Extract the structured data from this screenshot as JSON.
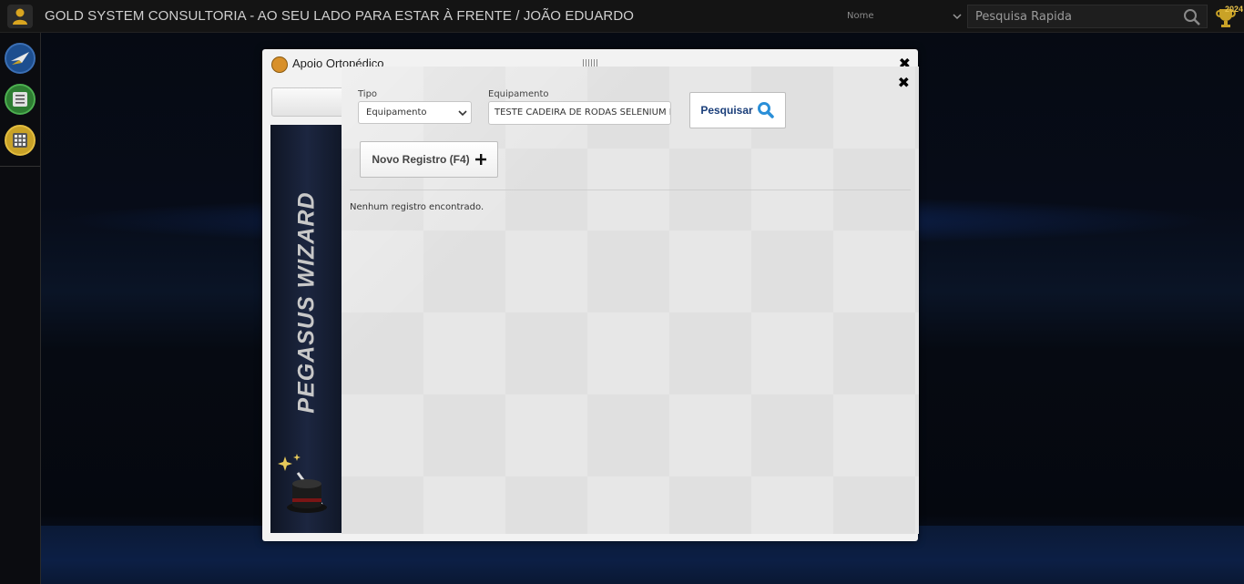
{
  "header": {
    "app_title": "GOLD SYSTEM CONSULTORIA - AO SEU LADO PARA ESTAR À FRENTE / JOÃO EDUARDO",
    "name_select": "Nome",
    "quick_search_placeholder": "Pesquisa Rapida",
    "badge_year": "2024"
  },
  "sidebar": {
    "items": [
      {
        "icon": "plane-icon",
        "color": "#1d4e8f"
      },
      {
        "icon": "list-icon",
        "color": "#2e7d32"
      },
      {
        "icon": "calculator-icon",
        "color": "#c9a227"
      }
    ]
  },
  "back_dialog": {
    "title": "Apoio Ortopédico",
    "close": "✖",
    "wizard_text": "PEGASUS WIZARD"
  },
  "dialog": {
    "close": "✖",
    "tipo_label": "Tipo",
    "tipo_value": "Equipamento",
    "equip_label": "Equipamento",
    "equip_value": "TESTE CADEIRA DE RODAS SELENIUM M",
    "search_button": "Pesquisar",
    "new_button": "Novo Registro (F4)",
    "empty_message": "Nenhum registro encontrado."
  },
  "colors": {
    "accent_blue": "#1a3e7a",
    "search_icon_blue": "#2a8fd8",
    "header_bg": "#141414"
  }
}
